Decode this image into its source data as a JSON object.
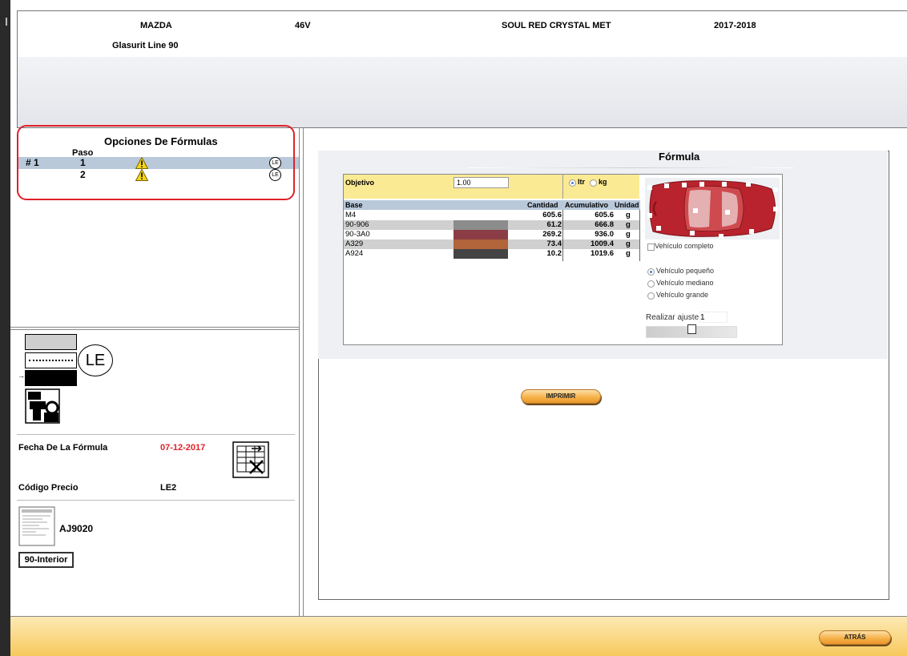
{
  "header": {
    "make": "MAZDA",
    "code": "46V",
    "color_name": "SOUL RED CRYSTAL MET",
    "years": "2017-2018",
    "line": "Glasurit Line 90"
  },
  "options": {
    "title": "Opciones De Fórmulas",
    "paso_header": "Paso",
    "rows": [
      {
        "num": "# 1",
        "paso": "1",
        "badge": "LE"
      },
      {
        "num": "",
        "paso": "2",
        "badge": "LE"
      }
    ]
  },
  "legend": {
    "le_label": "LE"
  },
  "details": {
    "fecha_label": "Fecha De La Fórmula",
    "fecha_value": "07-12-2017",
    "codigo_label": "Código Precio",
    "codigo_value": "LE2",
    "doc_code": "AJ9020",
    "interior_button": "90-Interior"
  },
  "formula": {
    "title": "Fórmula",
    "objetivo_label": "Objetivo",
    "objetivo_value": "1.00",
    "unit_ltr": "ltr",
    "unit_kg": "kg",
    "columns": {
      "base": "Base",
      "cantidad": "Cantidad",
      "acumulativo": "Acumulativo",
      "unidad": "Unidad"
    },
    "rows": [
      {
        "base": "M4",
        "cantidad": "605.6",
        "acumulativo": "605.6",
        "unidad": "g",
        "swatch": "#ffffff"
      },
      {
        "base": "90-906",
        "cantidad": "61.2",
        "acumulativo": "666.8",
        "unidad": "g",
        "swatch": "#8c8c8c"
      },
      {
        "base": "90-3A0",
        "cantidad": "269.2",
        "acumulativo": "936.0",
        "unidad": "g",
        "swatch": "#8b3d45"
      },
      {
        "base": "A329",
        "cantidad": "73.4",
        "acumulativo": "1009.4",
        "unidad": "g",
        "swatch": "#b2643a"
      },
      {
        "base": "A924",
        "cantidad": "10.2",
        "acumulativo": "1019.6",
        "unidad": "g",
        "swatch": "#444444"
      }
    ],
    "vehiculo_completo": "Vehículo completo",
    "sizes": [
      "Vehículo pequeño",
      "Vehículo mediano",
      "Vehículo grande"
    ],
    "ajuste_label": "Realizar ajuste:",
    "ajuste_value": "1",
    "print_button": "IMPRIMIR"
  },
  "footer": {
    "back_button": "ATRÁS"
  },
  "colors": {
    "selected_row": "#b9c9da",
    "objetivo_bg": "#fbea94",
    "highlight": "#e0202a",
    "car": "#b8232d",
    "footer": "#f7c95d"
  }
}
